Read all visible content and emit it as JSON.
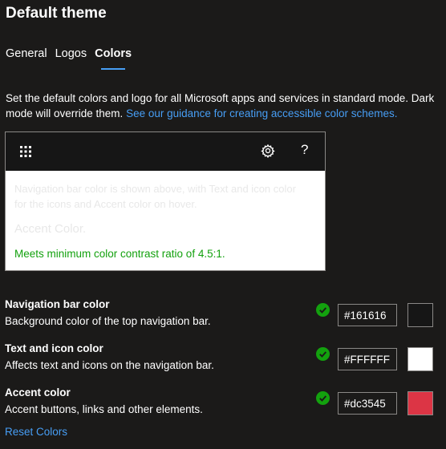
{
  "page": {
    "title": "Default theme"
  },
  "tabs": [
    {
      "label": "General",
      "active": false
    },
    {
      "label": "Logos",
      "active": false
    },
    {
      "label": "Colors",
      "active": true
    }
  ],
  "description": {
    "text": "Set the default colors and logo for all Microsoft apps and services in standard mode. Dark mode will override them. ",
    "link": "See our guidance for creating accessible color schemes."
  },
  "preview": {
    "nav_icons": [
      "waffle-icon",
      "gear-icon",
      "help-icon"
    ],
    "help_glyph": "?",
    "info_text": "Navigation bar color is shown above, with Text and icon color for the icons and Accent color on hover.",
    "accent_text": "Accent Color.",
    "contrast_text": "Meets minimum color contrast ratio of 4.5:1."
  },
  "colors": [
    {
      "label": "Navigation bar color",
      "desc": "Background color of the top navigation bar.",
      "value": "#161616",
      "swatch": "#161616"
    },
    {
      "label": "Text and icon color",
      "desc": "Affects text and icons on the navigation bar.",
      "value": "#FFFFFF",
      "swatch": "#FFFFFF"
    },
    {
      "label": "Accent color",
      "desc": "Accent buttons, links and other elements.",
      "value": "#dc3545",
      "swatch": "#dc3545"
    }
  ],
  "status_color": "#13a10e",
  "reset": {
    "label": "Reset Colors"
  }
}
